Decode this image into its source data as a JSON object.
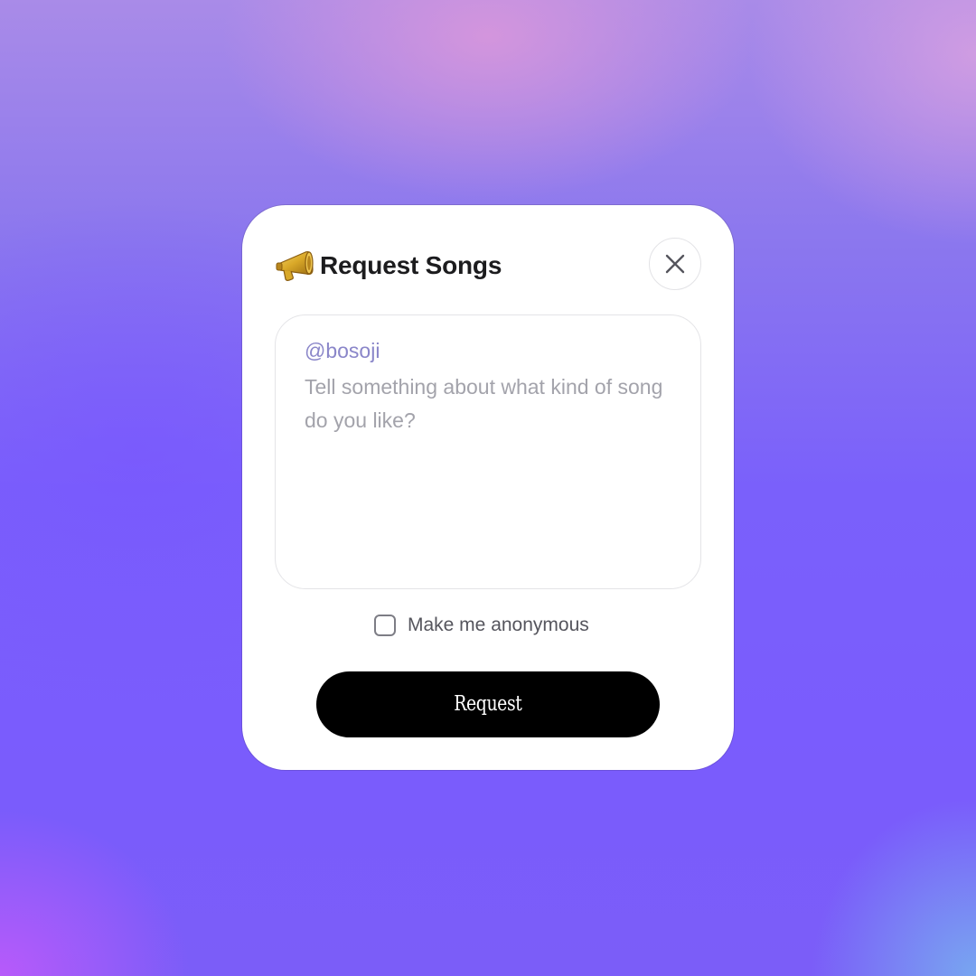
{
  "dialog": {
    "title": "Request Songs",
    "icon": "megaphone-icon",
    "close_icon": "close-icon"
  },
  "message": {
    "mention": "@bosoji",
    "placeholder": "Tell something about what kind of song do you like?"
  },
  "anonymous": {
    "label": "Make me anonymous",
    "checked": false
  },
  "submit": {
    "label": "Request"
  },
  "colors": {
    "card_bg": "#ffffff",
    "button_bg": "#000000",
    "mention": "#8a86c9",
    "placeholder": "#a3a3ab"
  }
}
